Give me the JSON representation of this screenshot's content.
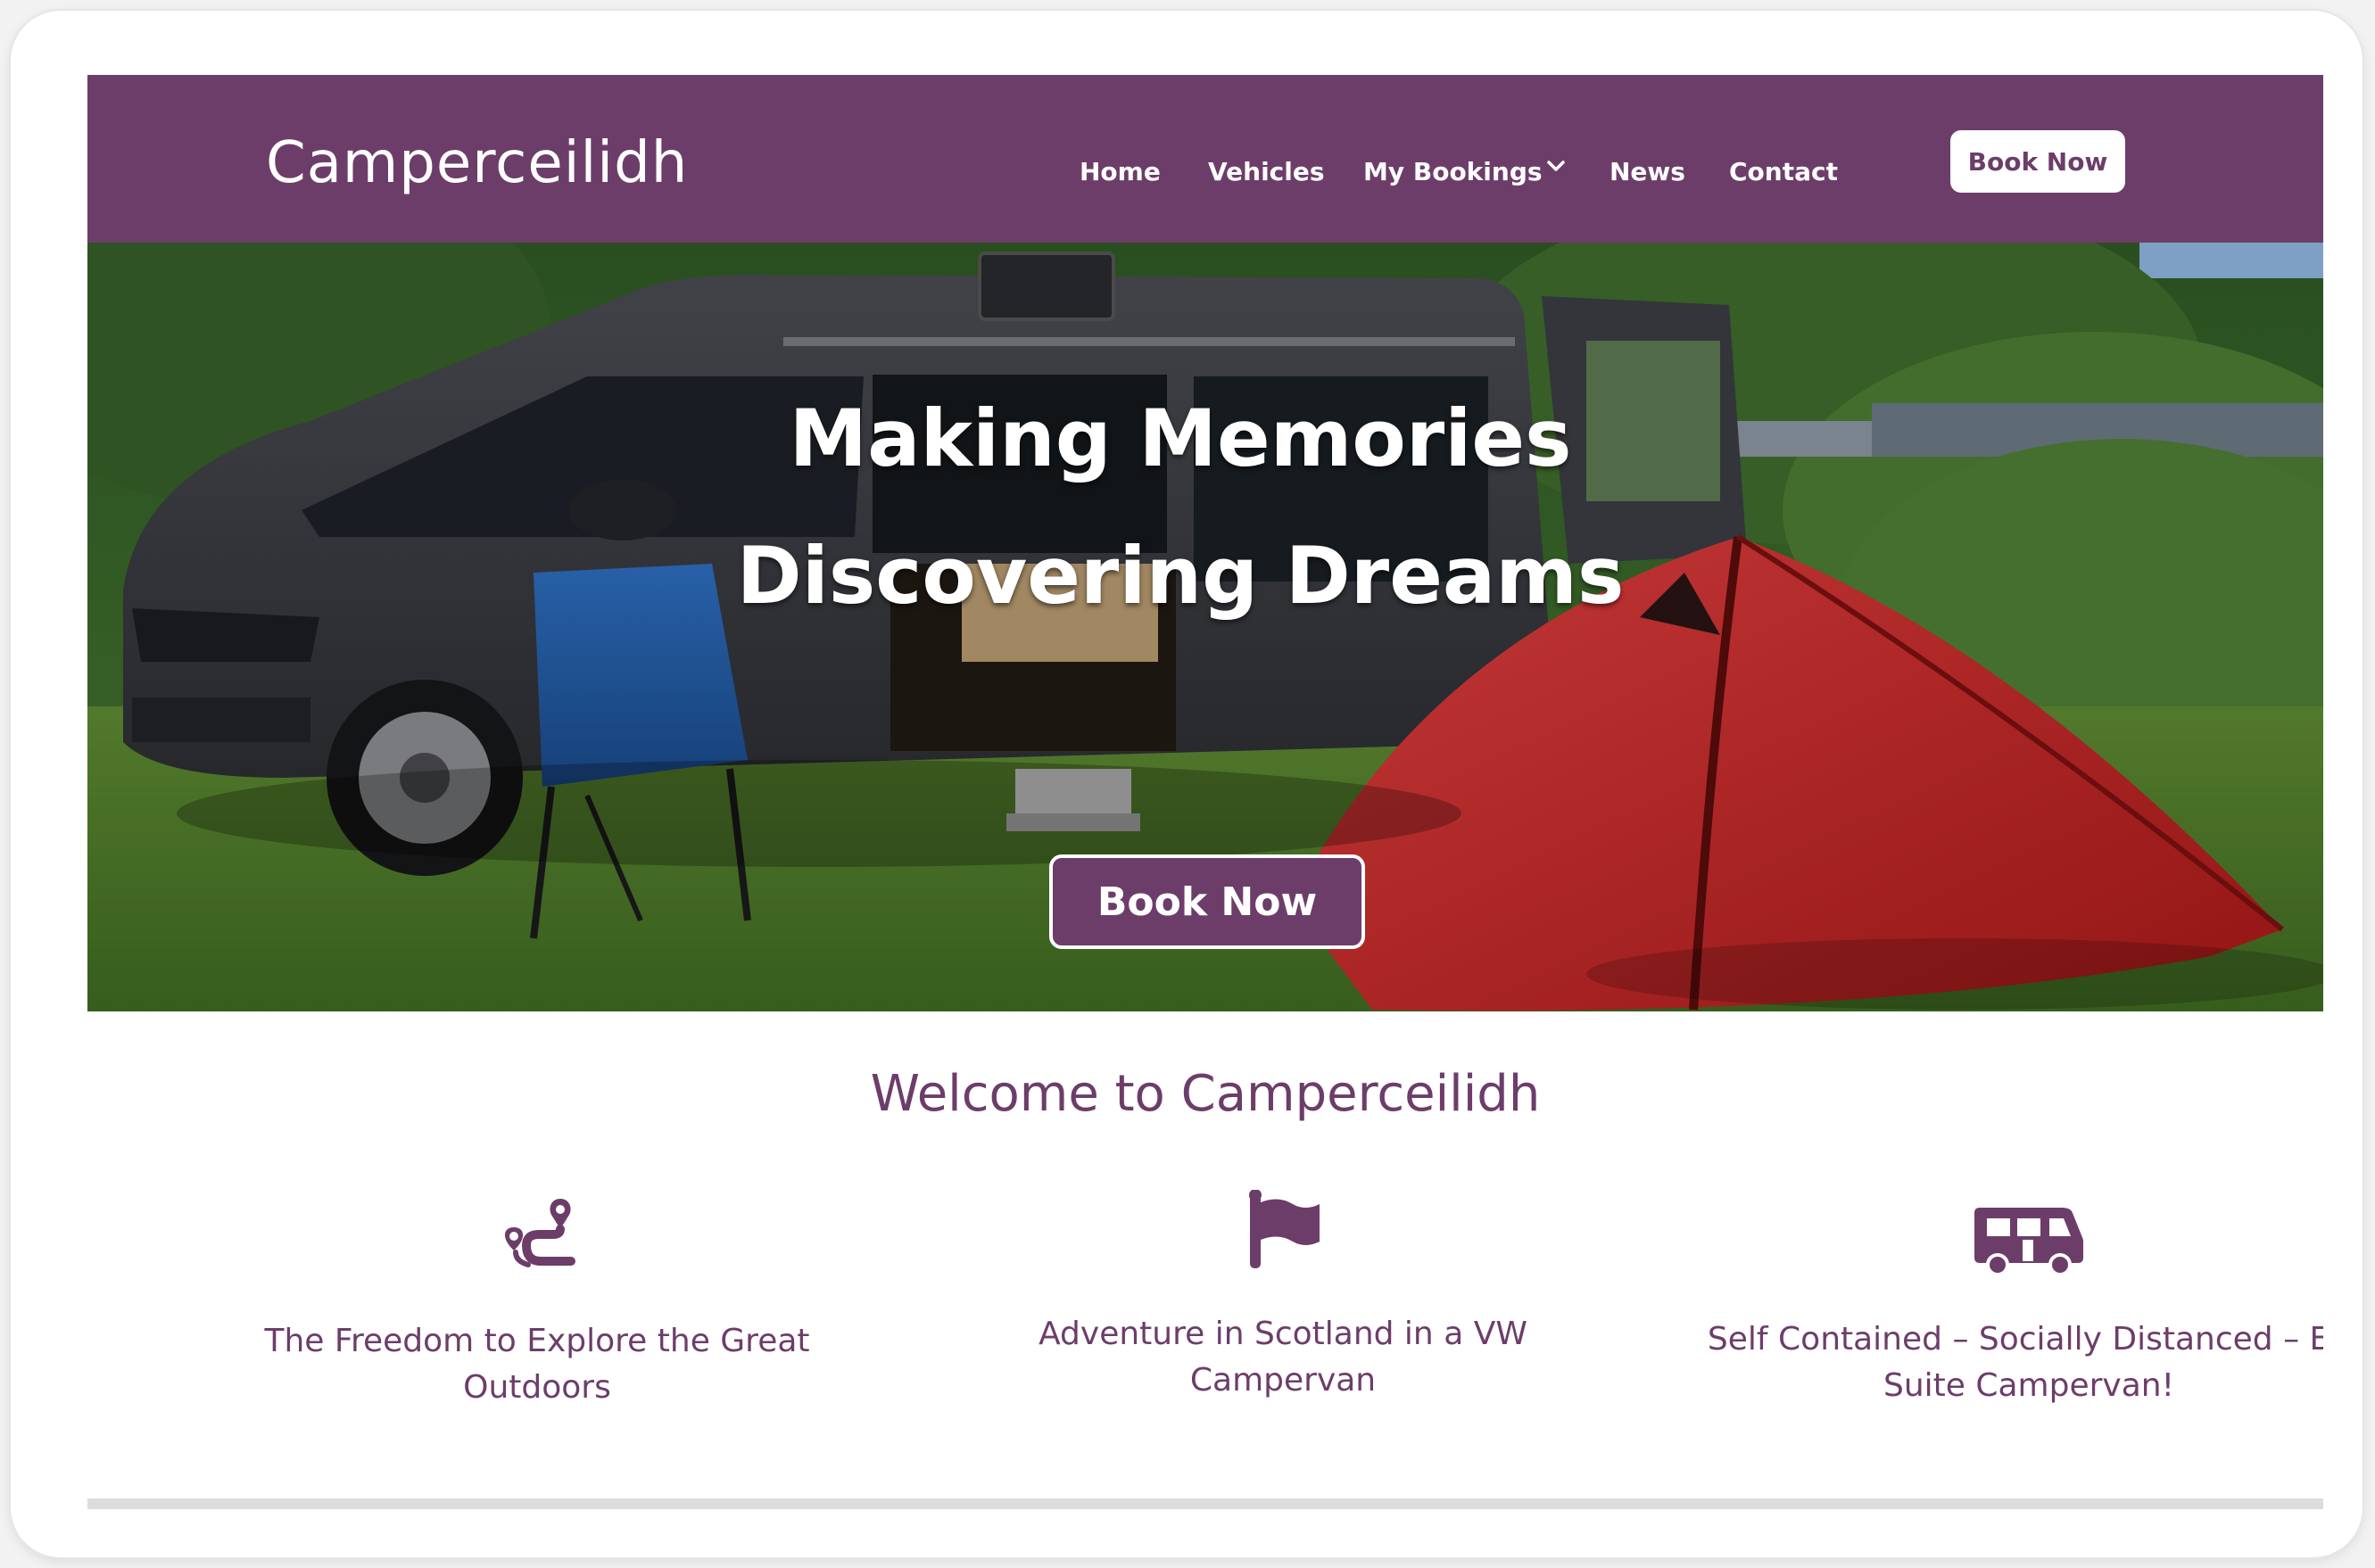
{
  "header": {
    "brand": "Camperceilidh",
    "nav": {
      "home": "Home",
      "vehicles": "Vehicles",
      "my_bookings": "My Bookings",
      "news": "News",
      "contact": "Contact"
    },
    "book_now": "Book Now"
  },
  "hero": {
    "title_line1": "Making Memories",
    "title_line2": "Discovering Dreams",
    "button": "Book Now"
  },
  "welcome": {
    "heading": "Welcome to Camperceilidh"
  },
  "features": [
    {
      "icon": "route-icon",
      "text": "The Freedom to Explore the Great Outdoors"
    },
    {
      "icon": "flag-icon",
      "text": "Adventure in Scotland in a VW Campervan"
    },
    {
      "icon": "campervan-icon",
      "text": "Self Contained – Socially Distanced – En Suite Campervan!"
    }
  ],
  "colors": {
    "brand": "#6d3d6a",
    "background": "#ffffff"
  }
}
